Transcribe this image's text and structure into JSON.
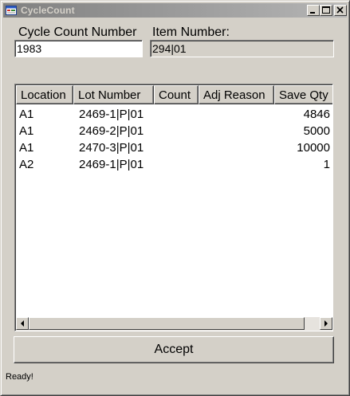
{
  "window": {
    "title": "CycleCount"
  },
  "form": {
    "cycle_count_label": "Cycle Count Number",
    "item_number_label": "Item Number:",
    "cycle_count_value": "1983",
    "item_number_value": "294|01"
  },
  "list": {
    "columns": [
      "Location",
      "Lot Number",
      "Count",
      "Adj Reason",
      "Save Qty"
    ],
    "rows": [
      {
        "location": "A1",
        "lot": "2469-1|P|01",
        "count": "",
        "adj_reason": "",
        "save_qty": "4846"
      },
      {
        "location": "A1",
        "lot": "2469-2|P|01",
        "count": "",
        "adj_reason": "",
        "save_qty": "5000"
      },
      {
        "location": "A1",
        "lot": "2470-3|P|01",
        "count": "",
        "adj_reason": "",
        "save_qty": "10000"
      },
      {
        "location": "A2",
        "lot": "2469-1|P|01",
        "count": "",
        "adj_reason": "",
        "save_qty": "1"
      }
    ]
  },
  "buttons": {
    "accept_label": "Accept"
  },
  "status": {
    "text": "Ready!"
  },
  "icons": {
    "app": "app-form-icon",
    "minimize": "minimize-icon",
    "maximize": "maximize-icon",
    "close": "close-icon",
    "scroll_left": "arrow-left-icon",
    "scroll_right": "arrow-right-icon"
  }
}
